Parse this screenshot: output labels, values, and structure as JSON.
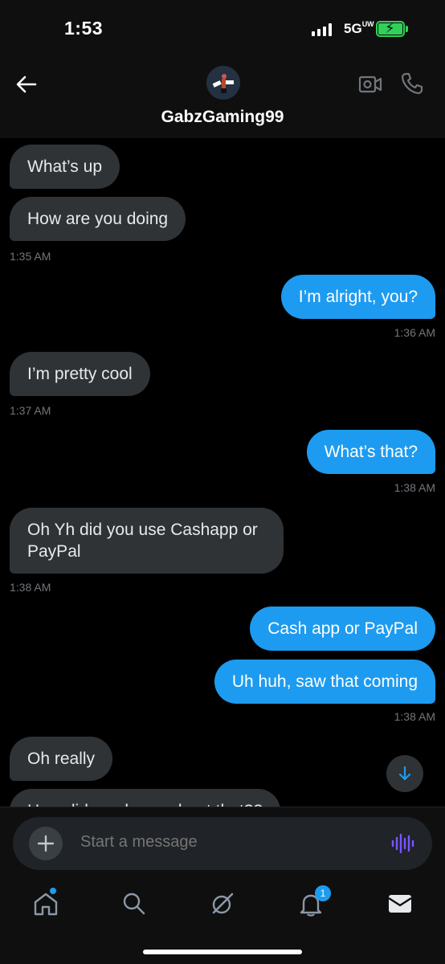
{
  "status_bar": {
    "time": "1:53",
    "network": "5G",
    "network_sup": "UW"
  },
  "header": {
    "contact_name": "GabzGaming99"
  },
  "messages": [
    {
      "direction": "in",
      "text": "What’s up"
    },
    {
      "direction": "in",
      "text": "How are you doing"
    },
    {
      "direction": "in",
      "timestamp": "1:35 AM"
    },
    {
      "direction": "out",
      "text": "I’m alright, you?"
    },
    {
      "direction": "out",
      "timestamp": "1:36 AM"
    },
    {
      "direction": "in",
      "text": "I’m pretty cool"
    },
    {
      "direction": "in",
      "timestamp": "1:37 AM"
    },
    {
      "direction": "out",
      "text": "What’s that?"
    },
    {
      "direction": "out",
      "timestamp": "1:38 AM"
    },
    {
      "direction": "in",
      "text": "Oh Yh did you use Cashapp or PayPal"
    },
    {
      "direction": "in",
      "timestamp": "1:38 AM"
    },
    {
      "direction": "out",
      "text": "Cash app or PayPal"
    },
    {
      "direction": "out",
      "text": "Uh huh, saw that coming"
    },
    {
      "direction": "out",
      "timestamp": "1:38 AM"
    },
    {
      "direction": "in",
      "text": "Oh really"
    },
    {
      "direction": "in",
      "text": "How did you know about that??"
    }
  ],
  "composer": {
    "placeholder": "Start a message"
  },
  "nav": {
    "notifications_badge": "1"
  },
  "colors": {
    "accent": "#1d9bf0",
    "incoming_bubble": "#2f3336",
    "background": "#000000",
    "voice_icon": "#7856ff"
  }
}
